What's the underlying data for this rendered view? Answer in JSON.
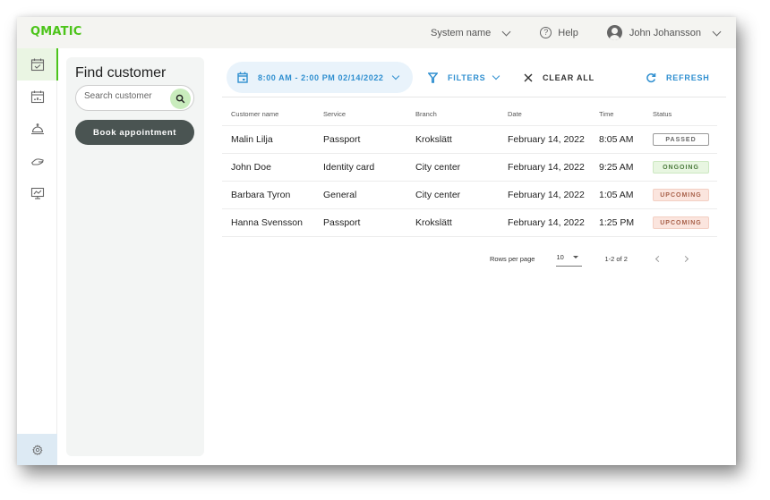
{
  "topbar": {
    "logo": "QMATIC",
    "system_name": "System name",
    "help": "Help",
    "user_name": "John Johansson"
  },
  "sidebar": {
    "items": [
      {
        "name": "appointments-icon",
        "active": true
      },
      {
        "name": "calendar-stats-icon",
        "active": false
      },
      {
        "name": "service-bell-icon",
        "active": false
      },
      {
        "name": "hand-icon",
        "active": false
      },
      {
        "name": "monitor-icon",
        "active": false
      }
    ],
    "settings_icon": "gear-icon"
  },
  "find_panel": {
    "title": "Find customer",
    "search_placeholder": "Search customer",
    "search_value": "",
    "book_button": "Book appointment"
  },
  "toolbar": {
    "date_range": "8:00 AM - 2:00 PM 02/14/2022",
    "filters": "FILTERS",
    "clear_all": "CLEAR ALL",
    "refresh": "REFRESH"
  },
  "colors": {
    "brand": "#4cc41a",
    "accent": "#2f8fd0",
    "dark_button": "#4a5452"
  },
  "table": {
    "columns": [
      "Customer name",
      "Service",
      "Branch",
      "Date",
      "Time",
      "Status"
    ],
    "rows": [
      {
        "name": "Malin Lilja",
        "service": "Passport",
        "branch": "Krokslätt",
        "date": "February 14, 2022",
        "time": "8:05 AM",
        "status": "PASSED"
      },
      {
        "name": "John Doe",
        "service": "Identity card",
        "branch": "City center",
        "date": "February 14, 2022",
        "time": "9:25 AM",
        "status": "ONGOING"
      },
      {
        "name": "Barbara Tyron",
        "service": "General",
        "branch": "City center",
        "date": "February 14, 2022",
        "time": "1:05 AM",
        "status": "UPCOMING"
      },
      {
        "name": "Hanna Svensson",
        "service": "Passport",
        "branch": "Krokslätt",
        "date": "February 14, 2022",
        "time": "1:25 PM",
        "status": "UPCOMING"
      }
    ]
  },
  "pagination": {
    "rows_per_page_label": "Rows per page",
    "rows_per_page": "10",
    "range": "1-2 of 2"
  }
}
